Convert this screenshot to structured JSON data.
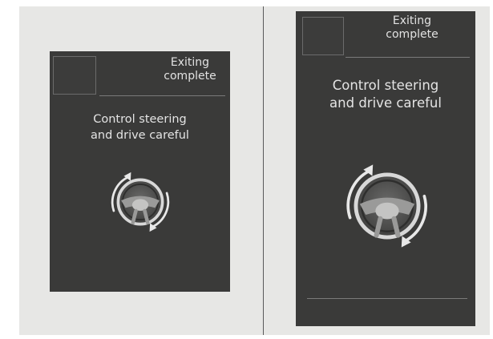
{
  "screens": [
    {
      "title_line1": "Exiting",
      "title_line2": "complete",
      "message_line1": "Control steering",
      "message_line2": "and drive careful"
    },
    {
      "title_line1": "Exiting",
      "title_line2": "complete",
      "message_line1": "Control steering",
      "message_line2": "and drive careful"
    }
  ],
  "icons": {
    "steering": "steering-wheel-icon",
    "rotate_arrows": "rotate-arrows-icon"
  },
  "colors": {
    "screen_background": "#3a3a39",
    "text": "#e2e2e2",
    "panel_background": "#e7e7e5"
  }
}
